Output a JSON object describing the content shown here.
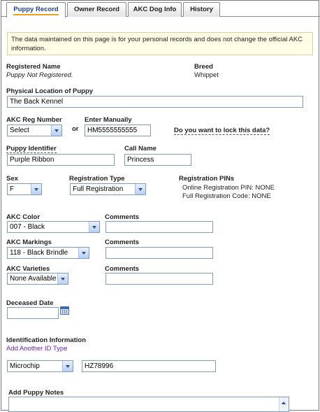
{
  "tabs": [
    {
      "label": "Puppy Record",
      "active": true
    },
    {
      "label": "Owner Record",
      "active": false
    },
    {
      "label": "AKC Dog Info",
      "active": false
    },
    {
      "label": "History",
      "active": false
    }
  ],
  "notice": "The data maintained on this page is for your personal records and does not change the official AKC information.",
  "registered_name": {
    "label": "Registered Name",
    "value": "Puppy Not Registered."
  },
  "breed": {
    "label": "Breed",
    "value": "Whippet"
  },
  "physical_location": {
    "label": "Physical Location of Puppy",
    "value": "The Back Kennel"
  },
  "akc_reg_number": {
    "label": "AKC Reg Number",
    "selected": "Select"
  },
  "or_text": "or",
  "enter_manually": {
    "label": "Enter Manually",
    "value": "HM5555555555"
  },
  "lock_link": "Do you want to lock this data?",
  "puppy_identifier": {
    "label": "Puppy Identifier",
    "value": "Purple Ribbon"
  },
  "call_name": {
    "label": "Call Name",
    "value": "Princess"
  },
  "sex": {
    "label": "Sex",
    "selected": "F"
  },
  "registration_type": {
    "label": "Registration Type",
    "selected": "Full Registration"
  },
  "registration_pins": {
    "label": "Registration PINs",
    "online": "Online Registration PIN: NONE",
    "full_code": "Full Registration Code: NONE"
  },
  "akc_color": {
    "label": "AKC Color",
    "selected": "007 - Black",
    "comments_label": "Comments",
    "comments": ""
  },
  "akc_markings": {
    "label": "AKC Markings",
    "selected": "118 - Black Brindle",
    "comments_label": "Comments",
    "comments": ""
  },
  "akc_varieties": {
    "label": "AKC Varieties",
    "selected": "None Available",
    "comments_label": "Comments",
    "comments": ""
  },
  "deceased_date": {
    "label": "Deceased Date",
    "value": ""
  },
  "identification": {
    "label": "Identification Information",
    "add_link": "Add Another ID Type",
    "type_selected": "Microchip",
    "value": "HZ78996"
  },
  "notes": {
    "label": "Add Puppy Notes",
    "value": ""
  }
}
